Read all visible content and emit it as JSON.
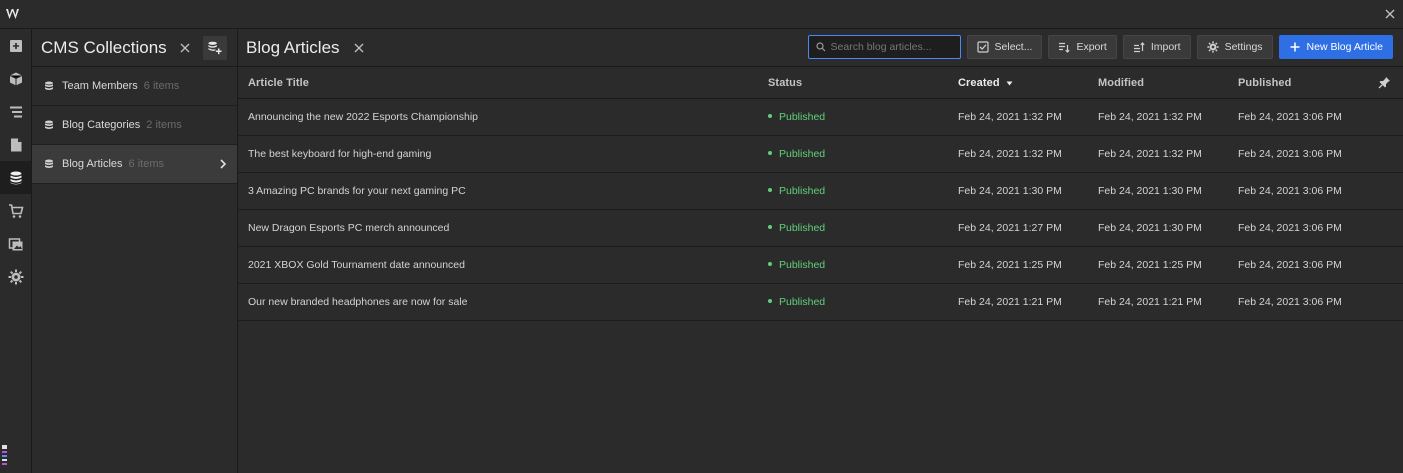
{
  "app": {
    "logo": "webflow-logo",
    "close_icon": "close-icon"
  },
  "rail": {
    "items": [
      {
        "icon": "add-panel-icon"
      },
      {
        "icon": "symbols-box-icon"
      },
      {
        "icon": "navigator-icon"
      },
      {
        "icon": "pages-icon"
      },
      {
        "icon": "database-icon",
        "active": true
      },
      {
        "icon": "cart-icon"
      },
      {
        "icon": "assets-icon"
      },
      {
        "icon": "gear-icon"
      }
    ]
  },
  "collections": {
    "title": "CMS Collections",
    "items": [
      {
        "name": "Team Members",
        "count": "6 items"
      },
      {
        "name": "Blog Categories",
        "count": "2 items"
      },
      {
        "name": "Blog Articles",
        "count": "6 items",
        "active": true
      }
    ]
  },
  "main": {
    "title": "Blog Articles",
    "search": {
      "placeholder": "Search blog articles...",
      "value": ""
    },
    "toolbar": {
      "select_label": "Select...",
      "export_label": "Export",
      "import_label": "Import",
      "settings_label": "Settings",
      "new_label": "New Blog Article"
    },
    "columns": [
      "Article Title",
      "Status",
      "Created",
      "Modified",
      "Published"
    ],
    "sorted_column": "Created",
    "rows": [
      {
        "title": "Announcing the new 2022 Esports Championship",
        "status": "Published",
        "created": "Feb 24, 2021 1:32 PM",
        "modified": "Feb 24, 2021 1:32 PM",
        "published": "Feb 24, 2021 3:06 PM"
      },
      {
        "title": "The best keyboard for high-end gaming",
        "status": "Published",
        "created": "Feb 24, 2021 1:32 PM",
        "modified": "Feb 24, 2021 1:32 PM",
        "published": "Feb 24, 2021 3:06 PM"
      },
      {
        "title": "3 Amazing PC brands for your next gaming PC",
        "status": "Published",
        "created": "Feb 24, 2021 1:30 PM",
        "modified": "Feb 24, 2021 1:30 PM",
        "published": "Feb 24, 2021 3:06 PM"
      },
      {
        "title": "New Dragon Esports PC merch announced",
        "status": "Published",
        "created": "Feb 24, 2021 1:27 PM",
        "modified": "Feb 24, 2021 1:30 PM",
        "published": "Feb 24, 2021 3:06 PM"
      },
      {
        "title": "2021 XBOX Gold Tournament date announced",
        "status": "Published",
        "created": "Feb 24, 2021 1:25 PM",
        "modified": "Feb 24, 2021 1:25 PM",
        "published": "Feb 24, 2021 3:06 PM"
      },
      {
        "title": "Our new branded headphones are now for sale",
        "status": "Published",
        "created": "Feb 24, 2021 1:21 PM",
        "modified": "Feb 24, 2021 1:21 PM",
        "published": "Feb 24, 2021 3:06 PM"
      }
    ]
  },
  "colors": {
    "accent": "#2f6fe6",
    "status_published": "#5fd07a",
    "background": "#2b2b2b"
  }
}
